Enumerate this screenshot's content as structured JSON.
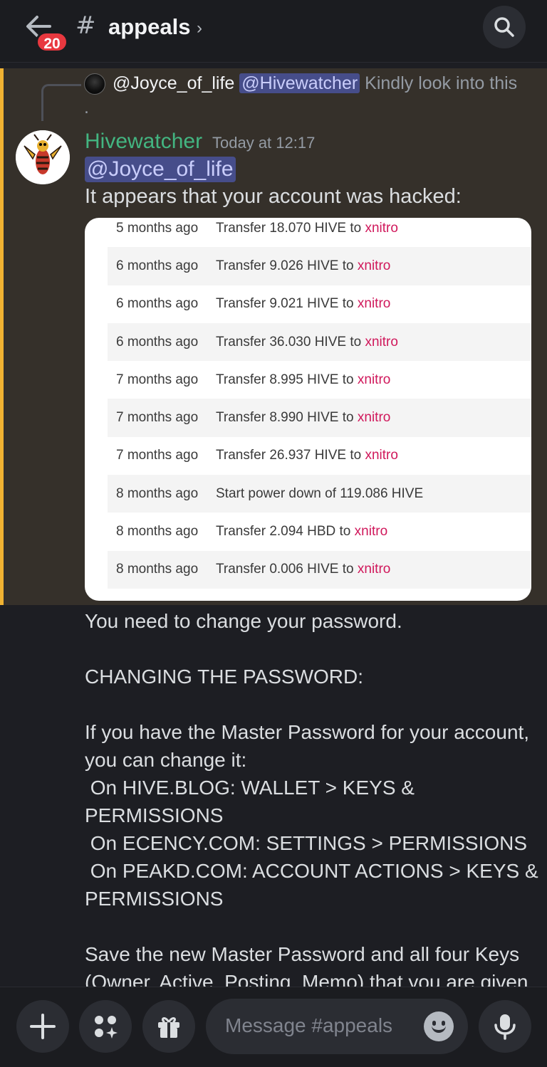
{
  "header": {
    "unread_count": "20",
    "hash": "#",
    "channel_name": "appeals",
    "chevron": "›"
  },
  "reply": {
    "user": "@Joyce_of_life",
    "mention": "@Hivewatcher",
    "text": "Kindly look into this ."
  },
  "message": {
    "author": "Hivewatcher",
    "timestamp": "Today at 12:17",
    "mention": "@Joyce_of_life",
    "line1": "It appears that your account was hacked:",
    "author_color": "#43b581"
  },
  "transactions": [
    {
      "when": "5 months ago",
      "what": "Transfer 18.070 HIVE to ",
      "to": "xnitro"
    },
    {
      "when": "6 months ago",
      "what": "Transfer 9.026 HIVE to ",
      "to": "xnitro"
    },
    {
      "when": "6 months ago",
      "what": "Transfer 9.021 HIVE to ",
      "to": "xnitro"
    },
    {
      "when": "6 months ago",
      "what": "Transfer 36.030 HIVE to ",
      "to": "xnitro"
    },
    {
      "when": "7 months ago",
      "what": "Transfer 8.995 HIVE to ",
      "to": "xnitro"
    },
    {
      "when": "7 months ago",
      "what": "Transfer 8.990 HIVE to ",
      "to": "xnitro"
    },
    {
      "when": "7 months ago",
      "what": "Transfer 26.937 HIVE to ",
      "to": "xnitro"
    },
    {
      "when": "8 months ago",
      "what": "Start power down of 119.086 HIVE",
      "to": ""
    },
    {
      "when": "8 months ago",
      "what": "Transfer 2.094 HBD to ",
      "to": "xnitro"
    },
    {
      "when": "8 months ago",
      "what": "Transfer 0.006 HIVE to ",
      "to": "xnitro"
    }
  ],
  "body": "You need to change your password.\n\nCHANGING THE PASSWORD:\n\nIf you have the Master Password for your account, you can change it:\n On HIVE.BLOG: WALLET > KEYS & PERMISSIONS\n On ECENCY.COM: SETTINGS > PERMISSIONS\n On PEAKD.COM: ACCOUNT ACTIONS > KEYS & PERMISSIONS\n\nSave the new Master Password and all four Keys (Owner, Active, Posting, Memo) that you are given",
  "composer": {
    "placeholder": "Message #appeals"
  },
  "icons": {
    "back": "arrow-left-icon",
    "search": "search-icon",
    "add": "plus-icon",
    "apps": "apps-icon",
    "gift": "gift-icon",
    "emoji": "emoji-icon",
    "mic": "microphone-icon"
  }
}
